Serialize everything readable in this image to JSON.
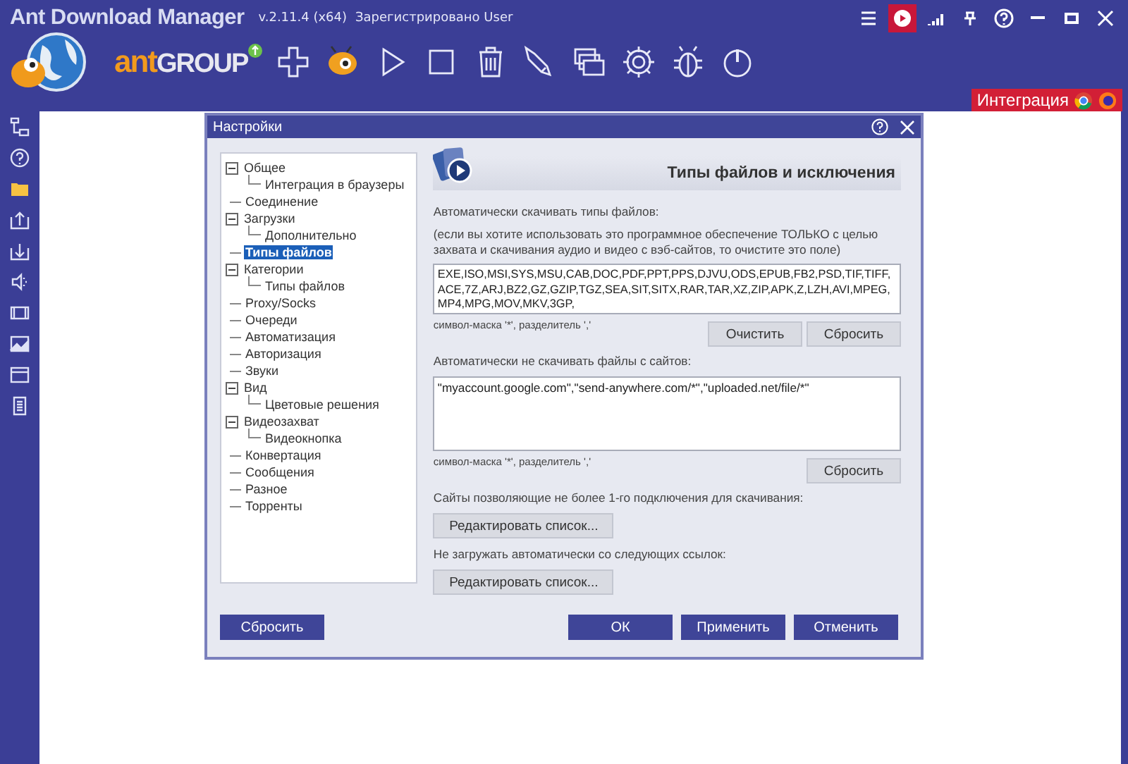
{
  "app": {
    "title": "Ant Download Manager",
    "version": "v.2.11.4 (x64)",
    "registration": "Зарегистрировано User"
  },
  "brand": {
    "part_1": "ant",
    "part_2": "GROUP"
  },
  "window_controls": [
    {
      "kind": "menu",
      "selected": false
    },
    {
      "kind": "play",
      "selected": true
    },
    {
      "kind": "levels",
      "selected": false
    },
    {
      "kind": "pin",
      "selected": false
    },
    {
      "kind": "help",
      "selected": false
    },
    {
      "kind": "minimize",
      "selected": false
    },
    {
      "kind": "maximize",
      "selected": false
    },
    {
      "kind": "close",
      "selected": false
    }
  ],
  "integration": {
    "label": "Интеграция"
  },
  "dialog": {
    "title": "Настройки",
    "tree": [
      {
        "label": "Общее",
        "selected": false,
        "expanded": true,
        "children": [
          {
            "label": "Интеграция в браузеры",
            "selected": false
          }
        ]
      },
      {
        "label": "Соединение",
        "selected": false
      },
      {
        "label": "Загрузки",
        "selected": false,
        "expanded": true,
        "children": [
          {
            "label": "Дополнительно",
            "selected": false
          }
        ]
      },
      {
        "label": "Типы файлов",
        "selected": true
      },
      {
        "label": "Категории",
        "selected": false,
        "expanded": true,
        "children": [
          {
            "label": "Типы файлов",
            "selected": false
          }
        ]
      },
      {
        "label": "Proxy/Socks",
        "selected": false
      },
      {
        "label": "Очереди",
        "selected": false
      },
      {
        "label": "Автоматизация",
        "selected": false
      },
      {
        "label": "Авторизация",
        "selected": false
      },
      {
        "label": "Звуки",
        "selected": false
      },
      {
        "label": "Вид",
        "selected": false,
        "expanded": true,
        "children": [
          {
            "label": "Цветовые решения",
            "selected": false
          }
        ]
      },
      {
        "label": "Видеозахват",
        "selected": false,
        "expanded": true,
        "children": [
          {
            "label": "Видеокнопка",
            "selected": false
          }
        ]
      },
      {
        "label": "Конвертация",
        "selected": false
      },
      {
        "label": "Сообщения",
        "selected": false
      },
      {
        "label": "Разное",
        "selected": false
      },
      {
        "label": "Торренты",
        "selected": false
      }
    ],
    "section_title": "Типы файлов и исключения",
    "auto_types_label": "Автоматически скачивать типы файлов:",
    "auto_types_hint": "(если вы хотите использовать это программное обеспечение ТОЛЬКО с целью захвата и скачивания аудио и видео с вэб-сайтов, то очистите это поле)",
    "auto_types_value": "EXE,ISO,MSI,SYS,MSU,CAB,DOC,PDF,PPT,PPS,DJVU,ODS,EPUB,FB2,PSD,TIF,TIFF,ACE,7Z,ARJ,BZ2,GZ,GZIP,TGZ,SEA,SIT,SITX,RAR,TAR,XZ,ZIP,APK,Z,LZH,AVI,MPEG,MP4,MPG,MOV,MKV,3GP,",
    "mask_note_1": "символ-маска '*', разделитель ','",
    "clear_button": "Очистить",
    "reset_button_1": "Сбросить",
    "exclude_label": "Автоматически не скачивать файлы с сайтов:",
    "exclude_value": "\"myaccount.google.com\",\"send-anywhere.com/*\",\"uploaded.net/file/*\"",
    "mask_note_2": "символ-маска '*', разделитель ','",
    "reset_button_2": "Сбросить",
    "single_conn_label": "Сайты позволяющие не более 1-го подключения для скачивания:",
    "edit_button_1": "Редактировать список...",
    "no_auto_label": "Не загружать автоматически со следующих ссылок:",
    "edit_button_2": "Редактировать список...",
    "footer_buttons": [
      {
        "label": "Сбросить",
        "kind": "left"
      },
      {
        "label": "ОК",
        "kind": "right"
      },
      {
        "label": "Применить",
        "kind": "right"
      },
      {
        "label": "Отменить",
        "kind": "right"
      }
    ]
  }
}
